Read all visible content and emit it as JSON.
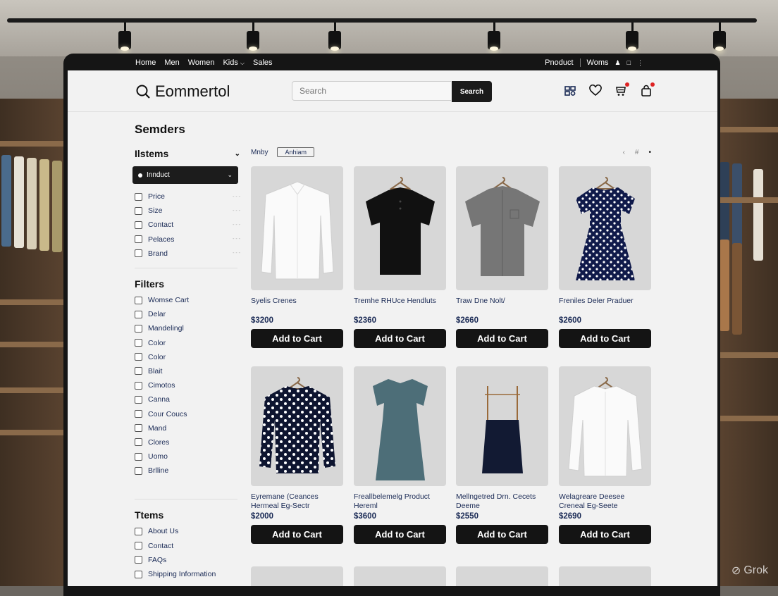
{
  "topnav": {
    "left": [
      "Home",
      "Men",
      "Women",
      "Kids",
      "Sales"
    ],
    "right": [
      "Pnoduct",
      "Woms"
    ]
  },
  "header": {
    "logo_text": "Eommertol",
    "search_placeholder": "Search",
    "search_button": "Search"
  },
  "sidebar": {
    "title": "Semders",
    "section1_title": "Ilstems",
    "dropdown_value": "Innduct",
    "section1_items": [
      "Price",
      "Size",
      "Contact",
      "Pelaces",
      "Brand"
    ],
    "section2_title": "Filters",
    "section2_items": [
      "Womse Cart",
      "Delar",
      "Mandelingl",
      "Color",
      "Color",
      "Blait",
      "Cimotos",
      "Canna",
      "Cour Coucs",
      "Mand",
      "Clores",
      "Uomo",
      "Brlline"
    ],
    "section3_title": "Ttems",
    "section3_items": [
      "About Us",
      "Contact",
      "FAQs",
      "Shipping Information"
    ]
  },
  "toolbar": {
    "sort_label": "Mnby",
    "chip": "Anhiam",
    "pager": [
      "‹",
      "#",
      "•"
    ]
  },
  "products": [
    {
      "name": "Syelis Crenes",
      "price": "$3200",
      "button": "Add to Cart",
      "garment": "white-shirt-icon"
    },
    {
      "name": "Tremhe RHUce Hendluts",
      "price": "$2360",
      "button": "Add to Cart",
      "garment": "black-polo-icon"
    },
    {
      "name": "Traw Dne Nolt/",
      "price": "$2660",
      "button": "Add to Cart",
      "garment": "gray-shirt-icon"
    },
    {
      "name": "Freniles Deler Praduer",
      "price": "$2600",
      "button": "Add to Cart",
      "garment": "polka-dress-icon"
    },
    {
      "name": "Eyremane (Ceances Hermeal Eg-Sectr",
      "price": "$2000",
      "button": "Add to Cart",
      "garment": "polka-blouse-icon"
    },
    {
      "name": "Freallbelemelg Product Hereml",
      "price": "$3600",
      "button": "Add to Cart",
      "garment": "teal-dress-icon"
    },
    {
      "name": "Mellngetred Drn. Cecets Deeme",
      "price": "$2550",
      "button": "Add to Cart",
      "garment": "navy-skirt-icon"
    },
    {
      "name": "Welagreare Deesee Creneal Eg-Seete",
      "price": "$2690",
      "button": "Add to Cart",
      "garment": "white-blouse-icon"
    }
  ],
  "watermark": "Grok",
  "colors": {
    "dark": "#141414",
    "navy_text": "#1a2a55",
    "screen_bg": "#f2f2f2",
    "notify": "#dd2222"
  }
}
